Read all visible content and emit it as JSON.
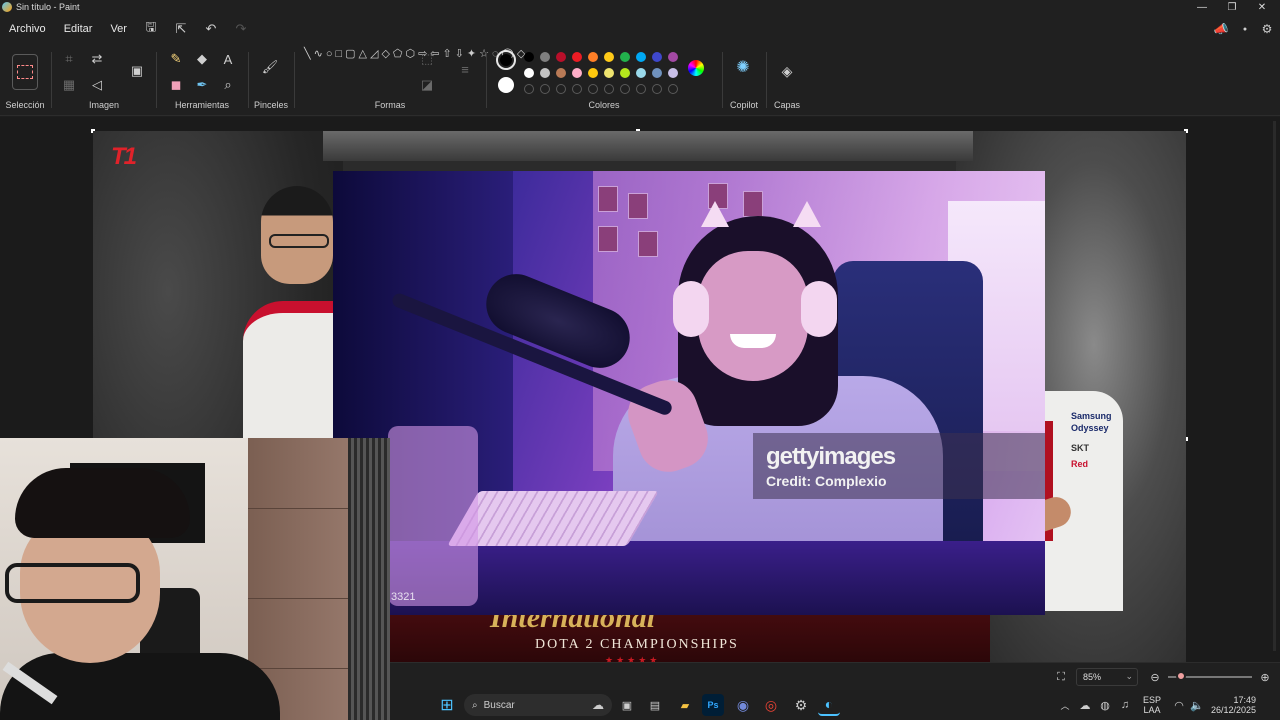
{
  "window": {
    "title": "Sin título - Paint",
    "minimize": "—",
    "restore": "❐",
    "close": "✕"
  },
  "menu": {
    "items": [
      "Archivo",
      "Editar",
      "Ver"
    ],
    "icons": [
      "save-icon",
      "share-icon",
      "undo-icon",
      "redo-icon"
    ],
    "right_icons": [
      "megaphone-icon",
      "account-icon",
      "settings-icon"
    ]
  },
  "ribbon": {
    "groups": {
      "selection": "Selección",
      "image": "Imagen",
      "tools": "Herramientas",
      "brushes": "Pinceles",
      "shapes": "Formas",
      "colors": "Colores",
      "copilot": "Copilot",
      "layers": "Capas"
    },
    "colors": {
      "primary": "#000000",
      "secondary": "#ffffff",
      "palette_row1": [
        "#000000",
        "#7f7f7f",
        "#b80f2a",
        "#ec1c24",
        "#ff7f27",
        "#ffca18",
        "#22b14c",
        "#00a8f3",
        "#3f48cc",
        "#a349a4"
      ],
      "palette_row2": [
        "#ffffff",
        "#c3c3c3",
        "#b97a56",
        "#ffaec8",
        "#ffc90e",
        "#eee36f",
        "#b5e61d",
        "#99d9ea",
        "#7092be",
        "#c8bfe7"
      ]
    }
  },
  "canvas": {
    "photo": {
      "watermark_brand": "gettyimages",
      "watermark_credit": "Credit: Complexio",
      "photo_id": "3321"
    },
    "banner": {
      "title": "International",
      "subtitle": "DOTA 2 CHAMPIONSHIPS",
      "stars": "★★★★★"
    },
    "logo": "T1",
    "jersey_text": [
      "Samsung",
      "Odyssey",
      "SKT",
      "Red"
    ]
  },
  "statusbar": {
    "zoom": "85%"
  },
  "taskbar": {
    "search_placeholder": "Buscar",
    "lang_top": "ESP",
    "lang_bottom": "LAA",
    "time": "17:49",
    "date": "26/12/2025"
  }
}
